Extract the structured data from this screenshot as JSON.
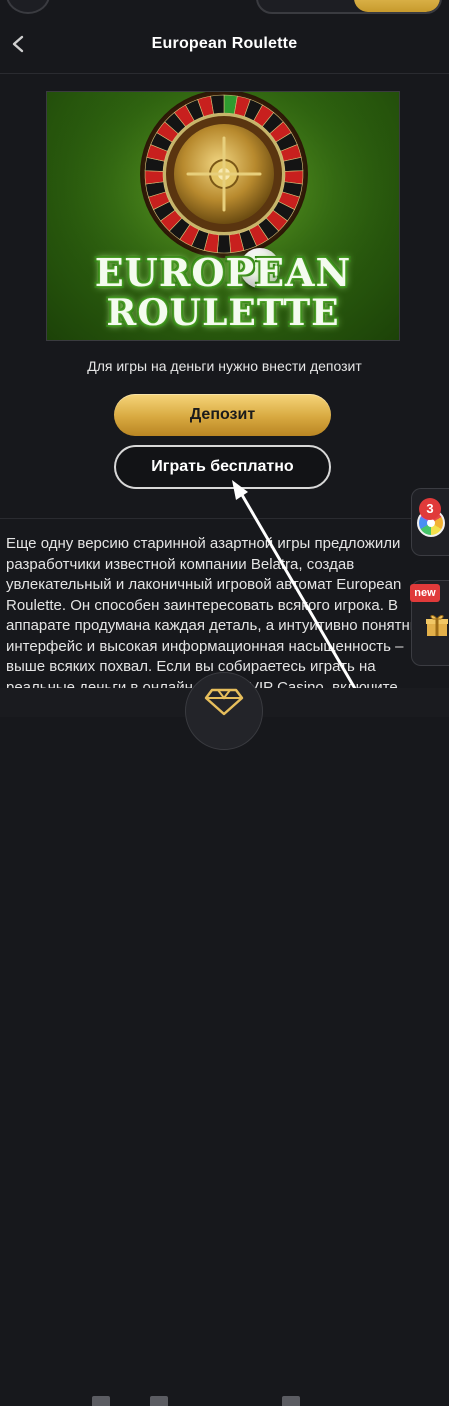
{
  "header": {
    "title": "European Roulette"
  },
  "game": {
    "logo_line1": "EUROPEAN",
    "logo_line2": "ROULETTE"
  },
  "deposit_note": "Для игры на деньги нужно внести депозит",
  "buttons": {
    "deposit": "Депозит",
    "play_free": "Играть бесплатно"
  },
  "description": "Еще одну версию старинной азартной игры предложили разработчики известной компании Belatra, создав увлекательный и лаконичный игровой автомат European Roulette. Он способен заинтересовать всякого игрока. В аппарате продумана каждая деталь, а интуитивно понятный интерфейс и высокая информационная насыщенность – выше всяких похвал. Если вы собираетесь играть на реальные деньги в онлайн-казино VIP Casino, включите",
  "widgets": {
    "wheel_badge": "3",
    "new_badge": "new"
  },
  "colors": {
    "accent_gold": "#d8a940",
    "background": "#17181c",
    "badge_red": "#e03a3a"
  },
  "icons": [
    "back-arrow-icon",
    "fortune-wheel-icon",
    "gift-icon",
    "diamond-icon"
  ]
}
